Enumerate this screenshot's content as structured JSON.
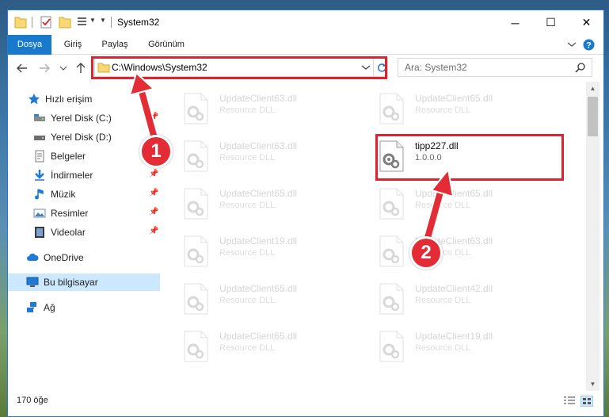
{
  "window": {
    "title": "System32",
    "controls": {
      "minimize": "─",
      "maximize": "☐",
      "close": "✕"
    }
  },
  "ribbon": {
    "tabs": [
      {
        "label": "Dosya",
        "active": true
      },
      {
        "label": "Giriş",
        "active": false
      },
      {
        "label": "Paylaş",
        "active": false
      },
      {
        "label": "Görünüm",
        "active": false
      }
    ],
    "expand_icon": "chevron-down-icon",
    "help_icon": "help-icon"
  },
  "navigation": {
    "back_icon": "arrow-left-icon",
    "forward_icon": "arrow-right-icon",
    "recent_icon": "chevron-down-icon",
    "up_icon": "arrow-up-icon"
  },
  "address": {
    "path": "C:\\Windows\\System32"
  },
  "search": {
    "placeholder": "Ara: System32"
  },
  "sidebar": {
    "items": [
      {
        "label": "Hızlı erişim",
        "icon": "star-icon",
        "level": 0,
        "pinned": false,
        "selected": false
      },
      {
        "label": "Yerel Disk (C:)",
        "icon": "drive-icon",
        "level": 1,
        "pinned": true,
        "selected": false
      },
      {
        "label": "Yerel Disk (D:)",
        "icon": "drive-icon",
        "level": 1,
        "pinned": true,
        "selected": false
      },
      {
        "label": "Belgeler",
        "icon": "documents-icon",
        "level": 1,
        "pinned": true,
        "selected": false
      },
      {
        "label": "İndirmeler",
        "icon": "download-icon",
        "level": 1,
        "pinned": true,
        "selected": false
      },
      {
        "label": "Müzik",
        "icon": "music-icon",
        "level": 1,
        "pinned": true,
        "selected": false
      },
      {
        "label": "Resimler",
        "icon": "pictures-icon",
        "level": 1,
        "pinned": true,
        "selected": false
      },
      {
        "label": "Videolar",
        "icon": "videos-icon",
        "level": 1,
        "pinned": true,
        "selected": false
      },
      {
        "label": "OneDrive",
        "icon": "cloud-icon",
        "level": 0,
        "pinned": false,
        "selected": false
      },
      {
        "label": "Bu bilgisayar",
        "icon": "computer-icon",
        "level": 0,
        "pinned": false,
        "selected": true
      },
      {
        "label": "Ağ",
        "icon": "network-icon",
        "level": 0,
        "pinned": false,
        "selected": false
      }
    ]
  },
  "files": [
    {
      "name": "UpdateClient63.dll",
      "desc": "Resource DLL",
      "highlighted": false
    },
    {
      "name": "UpdateClient65.dll",
      "desc": "Resource DLL",
      "highlighted": false
    },
    {
      "name": "UpdateClient63.dll",
      "desc": "Resource DLL",
      "highlighted": false
    },
    {
      "name": "tipp227.dll",
      "desc": "1.0.0.0",
      "highlighted": true
    },
    {
      "name": "UpdateClient65.dll",
      "desc": "Resource DLL",
      "highlighted": false
    },
    {
      "name": "UpdateClient65.dll",
      "desc": "Resource DLL",
      "highlighted": false
    },
    {
      "name": "UpdateClient19.dll",
      "desc": "Resource DLL",
      "highlighted": false
    },
    {
      "name": "UpdateClient63.dll",
      "desc": "Resource DLL",
      "highlighted": false
    },
    {
      "name": "UpdateClient65.dll",
      "desc": "Resource DLL",
      "highlighted": false
    },
    {
      "name": "UpdateClient42.dll",
      "desc": "Resource DLL",
      "highlighted": false
    },
    {
      "name": "UpdateClient65.dll",
      "desc": "Resource DLL",
      "highlighted": false
    },
    {
      "name": "UpdateClient19.dll",
      "desc": "Resource DLL",
      "highlighted": false
    }
  ],
  "status": {
    "count": "170 öğe"
  },
  "annotations": [
    {
      "number": "1",
      "target": "address-bar"
    },
    {
      "number": "2",
      "target": "tipp227.dll"
    }
  ],
  "colors": {
    "accent": "#1979ca",
    "highlight": "#e0222e",
    "selection": "#cce8ff"
  }
}
